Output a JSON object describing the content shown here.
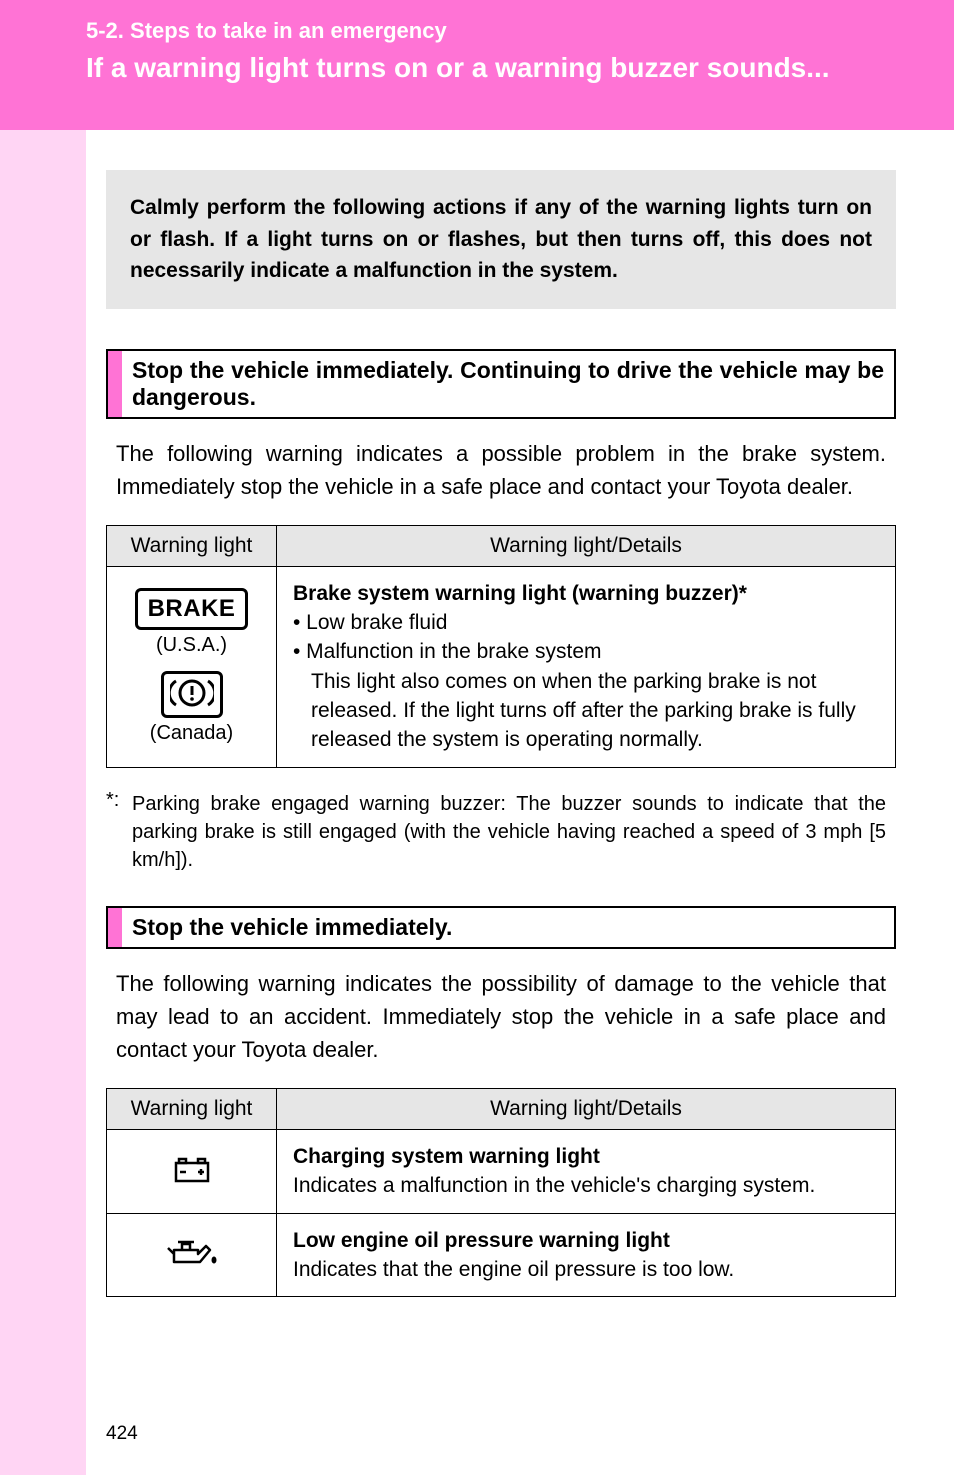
{
  "header": {
    "section_label": "5-2. Steps to take in an emergency",
    "page_title": "If a warning light turns on or a warning buzzer sounds..."
  },
  "intro": "Calmly perform the following actions if any of the warning lights turn on or flash. If a light turns on or flashes, but then turns off, this does not necessarily indicate a malfunction in the system.",
  "section1": {
    "heading": "Stop the vehicle immediately. Continuing to drive the vehicle may be dangerous.",
    "body": "The following warning indicates a possible problem in the brake system. Immediately stop the vehicle in a safe place and contact your Toyota dealer.",
    "table": {
      "col1": "Warning light",
      "col2": "Warning light/Details",
      "row1": {
        "icon_text": "BRAKE",
        "region_usa": "(U.S.A.)",
        "region_canada": "(Canada)",
        "title": "Brake system warning light (warning buzzer)*",
        "bullet1": "• Low brake fluid",
        "bullet2": "• Malfunction in the brake system",
        "sub": "This light also comes on when the parking brake is not released. If the light turns off after the parking brake is fully released the system is operating normally."
      }
    },
    "footnote_marker": "*:",
    "footnote": "Parking brake engaged warning buzzer: The buzzer sounds to indicate that the parking brake is still engaged (with the vehicle having reached a speed of 3 mph [5 km/h])."
  },
  "section2": {
    "heading": "Stop the vehicle immediately.",
    "body": "The following warning indicates the possibility of damage to the vehicle that may lead to an accident. Immediately stop the vehicle in a safe place and contact your Toyota dealer.",
    "table": {
      "col1": "Warning light",
      "col2": "Warning light/Details",
      "row1": {
        "title": "Charging system warning light",
        "desc": "Indicates a malfunction in the vehicle's charging system."
      },
      "row2": {
        "title": "Low engine oil pressure warning light",
        "desc": "Indicates that the engine oil pressure is too low."
      }
    }
  },
  "page_number": "424"
}
